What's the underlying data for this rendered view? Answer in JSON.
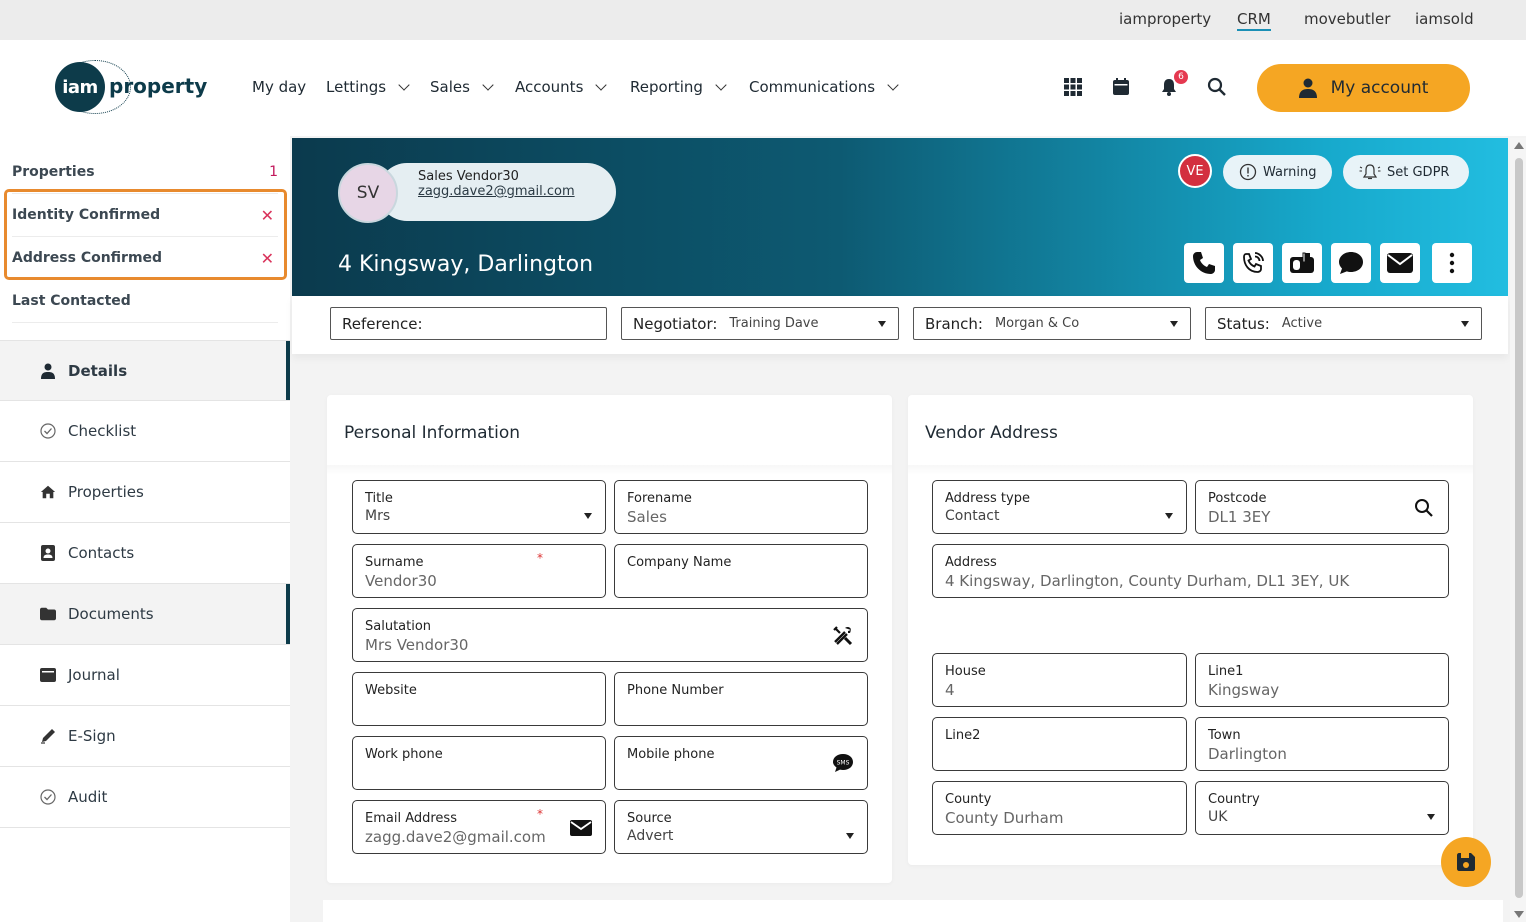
{
  "brandbar": {
    "links": [
      "iamproperty",
      "CRM",
      "movebutler",
      "iamsold"
    ],
    "active": "CRM"
  },
  "header": {
    "logo": {
      "mark": "iam",
      "word": "property"
    },
    "nav": [
      "My day",
      "Lettings",
      "Sales",
      "Accounts",
      "Reporting",
      "Communications"
    ],
    "notifications_count": "6",
    "my_account_label": "My account",
    "accent_color": "#f5a623"
  },
  "sidebar": {
    "properties_label": "Properties",
    "properties_count": "1",
    "identity_confirmed": "Identity Confirmed",
    "address_confirmed": "Address Confirmed",
    "last_contacted": "Last Contacted",
    "items": [
      {
        "label": "Details",
        "icon": "person-icon"
      },
      {
        "label": "Checklist",
        "icon": "check-circle-icon"
      },
      {
        "label": "Properties",
        "icon": "home-icon"
      },
      {
        "label": "Contacts",
        "icon": "contact-card-icon"
      },
      {
        "label": "Documents",
        "icon": "folder-icon"
      },
      {
        "label": "Journal",
        "icon": "journal-icon"
      },
      {
        "label": "E-Sign",
        "icon": "pen-icon"
      },
      {
        "label": "Audit",
        "icon": "check-circle-icon"
      }
    ]
  },
  "banner": {
    "initials": "SV",
    "contact_name": "Sales Vendor30",
    "contact_email": "zagg.dave2@gmail.com",
    "address": "4 Kingsway, Darlington",
    "ve_badge": "VE",
    "warning_label": "Warning",
    "gdpr_label": "Set GDPR"
  },
  "filters": {
    "reference_label": "Reference:",
    "reference_value": "",
    "negotiator_label": "Negotiator:",
    "negotiator_value": "Training Dave",
    "branch_label": "Branch:",
    "branch_value": "Morgan & Co",
    "status_label": "Status:",
    "status_value": "Active"
  },
  "personal": {
    "title": "Personal Information",
    "fields": {
      "title_label": "Title",
      "title_value": "Mrs",
      "forename_label": "Forename",
      "forename_value": "Sales",
      "surname_label": "Surname",
      "surname_value": "Vendor30",
      "company_label": "Company Name",
      "company_value": "",
      "salutation_label": "Salutation",
      "salutation_value": "Mrs Vendor30",
      "website_label": "Website",
      "website_value": "",
      "phone_label": "Phone Number",
      "phone_value": "",
      "work_label": "Work phone",
      "work_value": "",
      "mobile_label": "Mobile phone",
      "mobile_value": "",
      "email_label": "Email Address",
      "email_value": "zagg.dave2@gmail.com",
      "source_label": "Source",
      "source_value": "Advert",
      "required_mark": "*"
    }
  },
  "vendor": {
    "title": "Vendor Address",
    "fields": {
      "addrtype_label": "Address type",
      "addrtype_value": "Contact",
      "postcode_label": "Postcode",
      "postcode_value": "DL1 3EY",
      "address_label": "Address",
      "address_value": "4 Kingsway, Darlington, County Durham, DL1 3EY, UK",
      "house_label": "House",
      "house_value": "4",
      "line1_label": "Line1",
      "line1_value": "Kingsway",
      "line2_label": "Line2",
      "line2_value": "",
      "town_label": "Town",
      "town_value": "Darlington",
      "county_label": "County",
      "county_value": "County Durham",
      "country_label": "Country",
      "country_value": "UK"
    }
  }
}
